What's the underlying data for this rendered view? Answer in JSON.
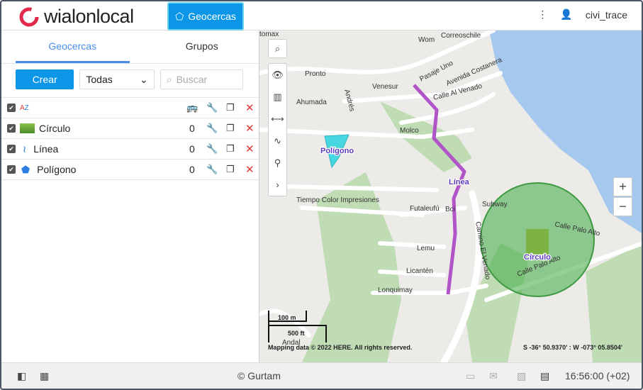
{
  "header": {
    "logo_text": "wialonlocal",
    "module_button": "Geocercas",
    "user": "civi_trace"
  },
  "sidebar": {
    "tabs": [
      {
        "label": "Geocercas",
        "active": true
      },
      {
        "label": "Grupos",
        "active": false
      }
    ],
    "create_label": "Crear",
    "filter_value": "Todas",
    "search_placeholder": "Buscar",
    "rows": [
      {
        "name": "Círculo",
        "count": "0",
        "icon": "image-thumbnail"
      },
      {
        "name": "Línea",
        "count": "0",
        "icon": "line-icon"
      },
      {
        "name": "Polígono",
        "count": "0",
        "icon": "polygon-icon"
      }
    ]
  },
  "map": {
    "labels": {
      "tomax": "tomax",
      "wom": "Wom",
      "correos": "Correoschile",
      "pronto": "Pronto",
      "venesur": "Venesur",
      "pasaje": "Pasaje Uno",
      "costanera": "Avenida Costanera",
      "venado": "Calle Al Venado",
      "ahumada": "Ahumada",
      "andres": "Andrés",
      "molco": "Molco",
      "tiempo": "Tiempo Color Impresiones",
      "futaleufu": "Futaleufú",
      "lemu": "Lemu",
      "licanten": "Licantén",
      "lonquimay": "Lonquimay",
      "camino": "Camino El Venado",
      "subway": "Subway",
      "bci": "Bci",
      "palo1": "Calle Palo Alto",
      "palo2": "Calle Palo Alto",
      "andal": "Andal"
    },
    "geofences": {
      "polygon": "Polígono",
      "line": "Línea",
      "circle": "Círculo"
    },
    "scale_m": "100 m",
    "scale_ft": "500 ft",
    "copyright": "Mapping data © 2022 HERE. All rights reserved.",
    "coords": "S -36° 50.9370' : W -073° 05.8504'",
    "colors": {
      "line": "#b054c8",
      "polygon": "#2bd4e0",
      "circle": "#4caf50",
      "water": "#a5c8ef",
      "green": "#bfdcb5"
    }
  },
  "footer": {
    "copyright": "© Gurtam",
    "time": "16:56:00 (+02)"
  }
}
